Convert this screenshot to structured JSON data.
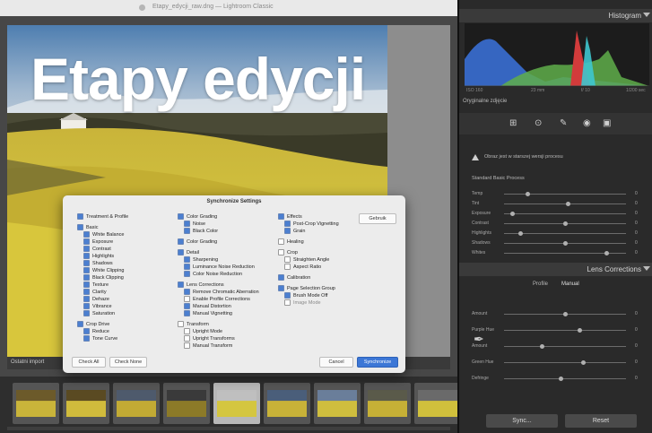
{
  "window": {
    "title": "Etapy_edycji_raw.dng — Lightroom Classic"
  },
  "overlay": {
    "headline": "Etapy edycji"
  },
  "status": {
    "text": "Ostatni import"
  },
  "filmstrip": {
    "count": 9
  },
  "dialog": {
    "title": "Synchronize Settings",
    "col1": [
      {
        "label": "Treatment & Profile",
        "level": 0,
        "on": true
      },
      {
        "label": "Basic",
        "level": 0,
        "on": true,
        "gap": true
      },
      {
        "label": "White Balance",
        "level": 1,
        "on": true
      },
      {
        "label": "Exposure",
        "level": 1,
        "on": true
      },
      {
        "label": "Contrast",
        "level": 1,
        "on": true
      },
      {
        "label": "Highlights",
        "level": 1,
        "on": true
      },
      {
        "label": "Shadows",
        "level": 1,
        "on": true
      },
      {
        "label": "White Clipping",
        "level": 1,
        "on": true
      },
      {
        "label": "Black Clipping",
        "level": 1,
        "on": true
      },
      {
        "label": "Texture",
        "level": 1,
        "on": true
      },
      {
        "label": "Clarity",
        "level": 1,
        "on": true
      },
      {
        "label": "Dehaze",
        "level": 1,
        "on": true
      },
      {
        "label": "Vibrance",
        "level": 1,
        "on": true
      },
      {
        "label": "Saturation",
        "level": 1,
        "on": true
      },
      {
        "label": "Crop Drive",
        "level": 0,
        "on": true,
        "gap": true
      },
      {
        "label": "Reduce",
        "level": 1,
        "on": true
      },
      {
        "label": "Tone Curve",
        "level": 1,
        "on": true
      }
    ],
    "col2": [
      {
        "label": "Color Grading",
        "level": 0,
        "on": true
      },
      {
        "label": "Noise",
        "level": 1,
        "on": true
      },
      {
        "label": "Black Color",
        "level": 1,
        "on": true
      },
      {
        "label": "Color Grading",
        "level": 0,
        "on": true,
        "gap": true
      },
      {
        "label": "Detail",
        "level": 0,
        "on": true,
        "gap": true
      },
      {
        "label": "Sharpening",
        "level": 1,
        "on": true
      },
      {
        "label": "Luminance Noise Reduction",
        "level": 1,
        "on": true
      },
      {
        "label": "Color Noise Reduction",
        "level": 1,
        "on": true
      },
      {
        "label": "Lens Corrections",
        "level": 0,
        "on": true,
        "gap": true
      },
      {
        "label": "Remove Chromatic Aberration",
        "level": 1,
        "on": true
      },
      {
        "label": "Enable Profile Corrections",
        "level": 1,
        "on": false
      },
      {
        "label": "Manual Distortion",
        "level": 1,
        "on": true
      },
      {
        "label": "Manual Vignetting",
        "level": 1,
        "on": true
      },
      {
        "label": "Transform",
        "level": 0,
        "on": false,
        "gap": true
      },
      {
        "label": "Upright Mode",
        "level": 1,
        "on": false
      },
      {
        "label": "Upright Transforms",
        "level": 1,
        "on": false
      },
      {
        "label": "Manual Transform",
        "level": 1,
        "on": false
      }
    ],
    "col3": [
      {
        "label": "Effects",
        "level": 0,
        "on": true
      },
      {
        "label": "Post-Crop Vignetting",
        "level": 1,
        "on": true
      },
      {
        "label": "Grain",
        "level": 1,
        "on": true
      },
      {
        "label": "Healing",
        "level": 0,
        "on": false,
        "gap": true
      },
      {
        "label": "Crop",
        "level": 0,
        "on": false,
        "gap": true
      },
      {
        "label": "Straighten Angle",
        "level": 1,
        "on": false
      },
      {
        "label": "Aspect Ratio",
        "level": 1,
        "on": false
      },
      {
        "label": "Calibration",
        "level": 0,
        "on": true,
        "gap": true
      },
      {
        "label": "Page Selection Group",
        "level": 0,
        "on": true,
        "gap": true
      },
      {
        "label": "Brush Mode Off",
        "level": 1,
        "on": true
      },
      {
        "label": "Image Mode",
        "level": 1,
        "on": false,
        "dim": true
      }
    ],
    "right_btn": "Gebruik",
    "check_all": "Check All",
    "check_none": "Check None",
    "cancel": "Cancel",
    "sync": "Synchronize"
  },
  "panel": {
    "histogram_title": "Histogram",
    "hist_labels": [
      "ISO 160",
      "23 mm",
      "f/ 10",
      "1/200 sec"
    ],
    "original_photo": "Oryginalne zdjęcie",
    "warning": "Obraz jest w starszej wersji procesu",
    "process_label": "Standard Basic Process",
    "lens_title": "Lens Corrections",
    "lens_tabs": [
      "Profile",
      "Manual"
    ],
    "sliders_top": [
      {
        "label": "Temp",
        "value": "0",
        "pos": 0.18
      },
      {
        "label": "Tint",
        "value": "0",
        "pos": 0.52
      },
      {
        "label": "Exposure",
        "value": "0",
        "pos": 0.05
      },
      {
        "label": "Contrast",
        "value": "0",
        "pos": 0.5
      },
      {
        "label": "Highlights",
        "value": "0",
        "pos": 0.12
      },
      {
        "label": "Shadows",
        "value": "0",
        "pos": 0.5
      },
      {
        "label": "Whites",
        "value": "0",
        "pos": 0.85
      }
    ],
    "sliders_bottom": [
      {
        "label": "Amount",
        "value": "0",
        "pos": 0.5
      },
      {
        "label": "Purple Hue",
        "value": "0",
        "pos": 0.62
      },
      {
        "label": "Amount",
        "value": "0",
        "pos": 0.3
      },
      {
        "label": "Green Hue",
        "value": "0",
        "pos": 0.65
      },
      {
        "label": "Defringe",
        "value": "0",
        "pos": 0.46
      }
    ],
    "prev_btn": "Sync...",
    "reset_btn": "Reset"
  }
}
